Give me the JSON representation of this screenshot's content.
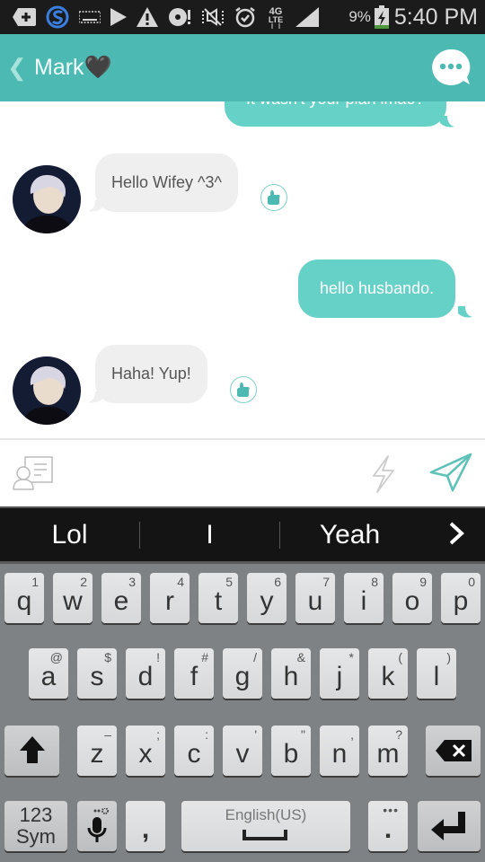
{
  "status_bar": {
    "icons": [
      "add-notification-icon",
      "swype-icon",
      "keyboard-icon",
      "play-icon",
      "warning-icon",
      "disc-alert-icon",
      "mute-icon",
      "alarm-icon",
      "4g-lte-icon",
      "signal-icon",
      "battery-charging-icon"
    ],
    "battery_percent": "9%",
    "time": "5:40 PM"
  },
  "header": {
    "back_label": "❮",
    "title": "Mark",
    "title_emoji": "🖤",
    "more_icon": "chat-more-icon",
    "color": "#4cbab2"
  },
  "messages": [
    {
      "side": "out",
      "text": "It wasn't your plan lmao?",
      "clipped": true
    },
    {
      "side": "in",
      "sender": "Mark",
      "text": "Hello Wifey ^3^",
      "has_like": true
    },
    {
      "side": "out",
      "text": "hello husbando."
    },
    {
      "side": "in",
      "sender": "Mark",
      "text": "Haha! Yup!",
      "has_like": true
    }
  ],
  "colors": {
    "outgoing_bubble": "#66d1c7",
    "incoming_bubble": "#efefef",
    "accent": "#4cbab2"
  },
  "input_bar": {
    "contact_icon": "contact-card-icon",
    "bolt_icon": "lightning-icon",
    "send_icon": "send-icon",
    "value": ""
  },
  "suggestions": [
    "Lol",
    "I",
    "Yeah"
  ],
  "suggestion_more": "›",
  "keyboard": {
    "row1": [
      {
        "k": "q",
        "s": "1"
      },
      {
        "k": "w",
        "s": "2"
      },
      {
        "k": "e",
        "s": "3"
      },
      {
        "k": "r",
        "s": "4"
      },
      {
        "k": "t",
        "s": "5"
      },
      {
        "k": "y",
        "s": "6"
      },
      {
        "k": "u",
        "s": "7"
      },
      {
        "k": "i",
        "s": "8"
      },
      {
        "k": "o",
        "s": "9"
      },
      {
        "k": "p",
        "s": "0"
      }
    ],
    "row2": [
      {
        "k": "a",
        "s": "@"
      },
      {
        "k": "s",
        "s": "$"
      },
      {
        "k": "d",
        "s": "!"
      },
      {
        "k": "f",
        "s": "#"
      },
      {
        "k": "g",
        "s": "/"
      },
      {
        "k": "h",
        "s": "&"
      },
      {
        "k": "j",
        "s": "*"
      },
      {
        "k": "k",
        "s": "("
      },
      {
        "k": "l",
        "s": ")"
      }
    ],
    "row3": [
      {
        "k": "z",
        "s": "–"
      },
      {
        "k": "x",
        "s": ";"
      },
      {
        "k": "c",
        "s": ":"
      },
      {
        "k": "v",
        "s": "'"
      },
      {
        "k": "b",
        "s": "\""
      },
      {
        "k": "n",
        "s": ","
      },
      {
        "k": "m",
        "s": "?"
      }
    ],
    "sym_line1": "123",
    "sym_line2": "Sym",
    "comma": ",",
    "space_label": "English(US)",
    "period": ".",
    "period_sub": "•••"
  }
}
